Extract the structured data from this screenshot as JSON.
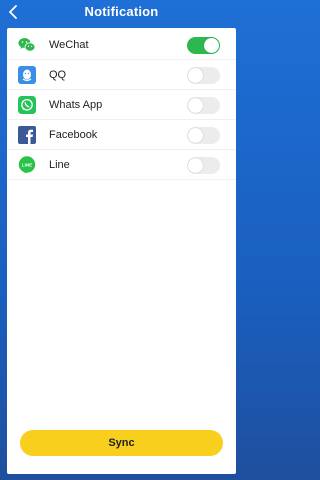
{
  "header": {
    "title": "Notification"
  },
  "apps": [
    {
      "label": "WeChat",
      "icon": "wechat-icon",
      "enabled": true
    },
    {
      "label": "QQ",
      "icon": "qq-icon",
      "enabled": false
    },
    {
      "label": "Whats App",
      "icon": "whatsapp-icon",
      "enabled": false
    },
    {
      "label": "Facebook",
      "icon": "facebook-icon",
      "enabled": false
    },
    {
      "label": "Line",
      "icon": "line-icon",
      "enabled": false
    }
  ],
  "line_icon_text": "LINE",
  "sync_label": "Sync",
  "colors": {
    "header_bg": "#1e6fd6",
    "toggle_on": "#2db84f",
    "toggle_off": "#ececec",
    "sync_button": "#f7cf1c"
  }
}
